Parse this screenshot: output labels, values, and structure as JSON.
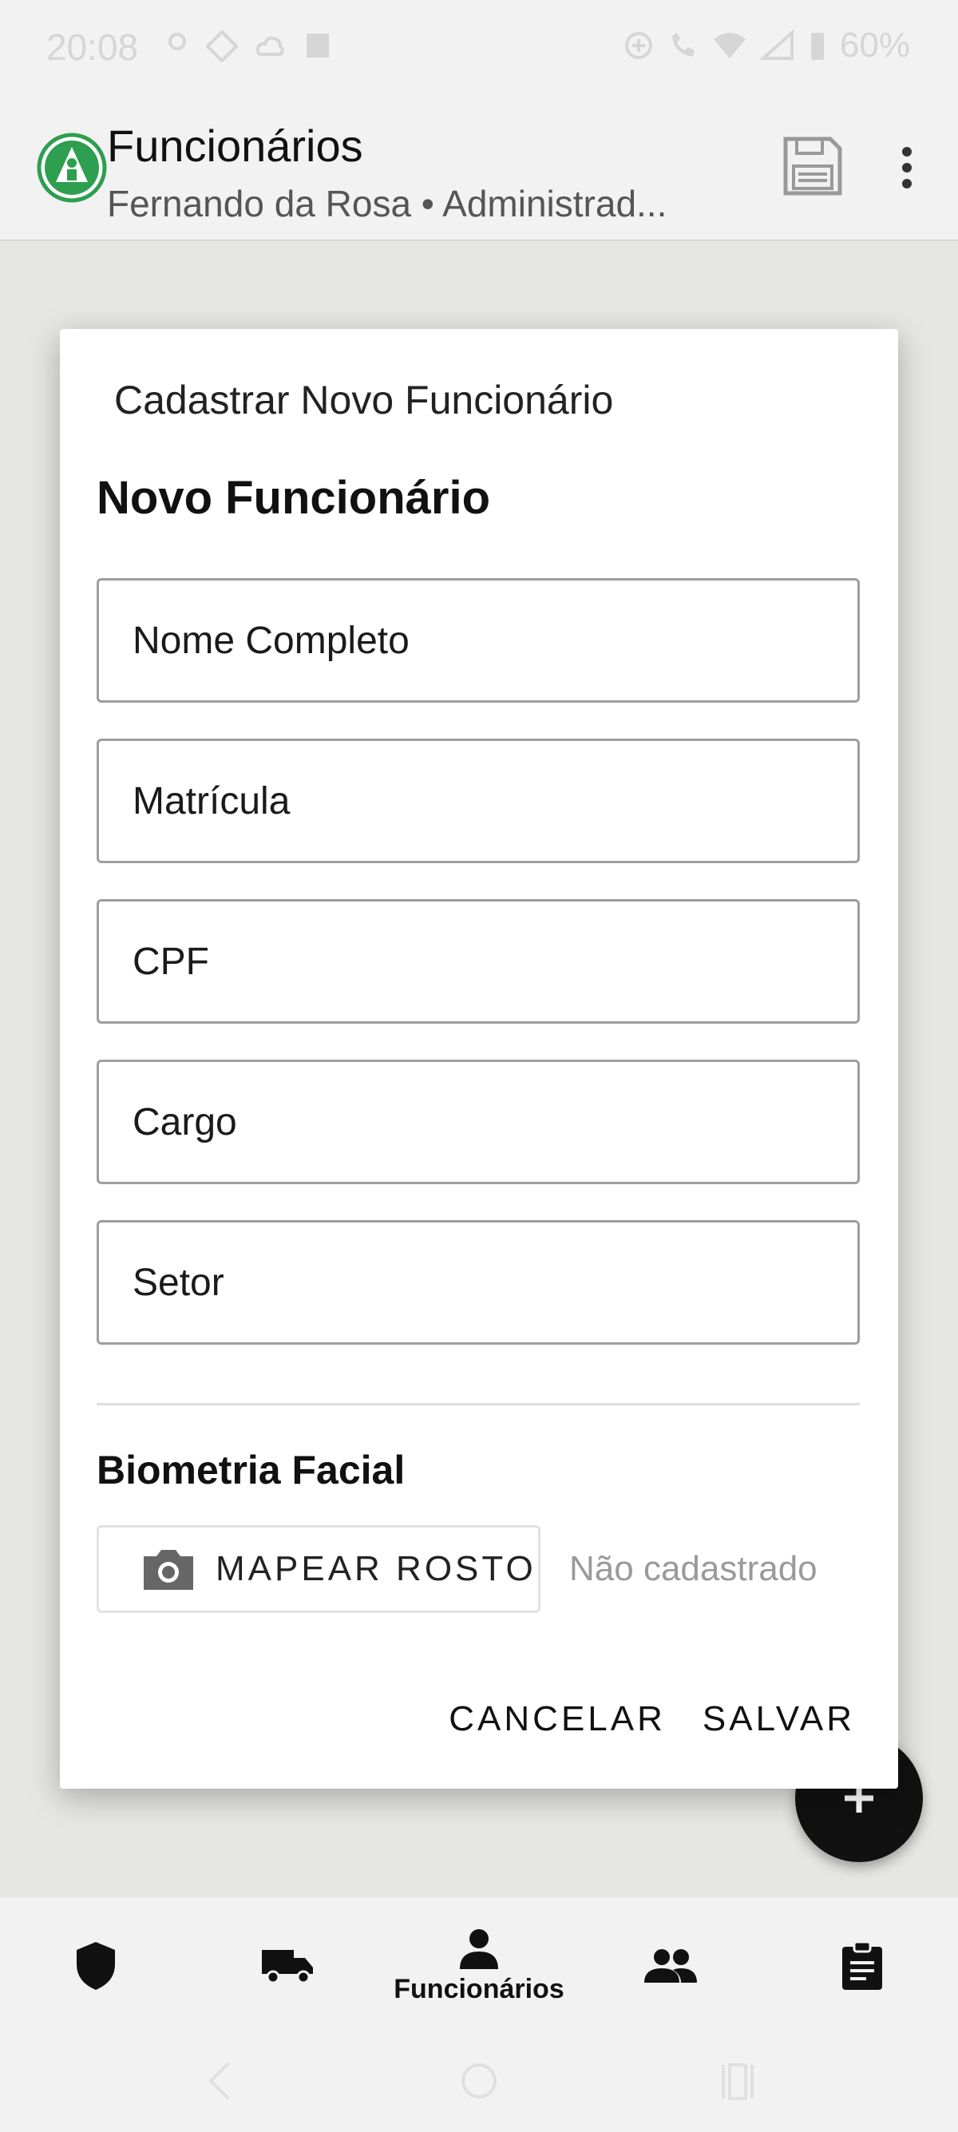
{
  "status_bar": {
    "time": "20:08",
    "battery": "60%"
  },
  "app_bar": {
    "title": "Funcionários",
    "subtitle": "Fernando da Rosa • Administrad..."
  },
  "dialog": {
    "title": "Cadastrar Novo Funcionário",
    "heading": "Novo Funcionário",
    "fields": [
      {
        "placeholder": "Nome Completo",
        "value": ""
      },
      {
        "placeholder": "Matrícula",
        "value": ""
      },
      {
        "placeholder": "CPF",
        "value": ""
      },
      {
        "placeholder": "Cargo",
        "value": ""
      },
      {
        "placeholder": "Setor",
        "value": ""
      }
    ],
    "biometrics": {
      "heading": "Biometria Facial",
      "button_label": "MAPEAR ROSTO",
      "button_icon": "camera-icon",
      "status": "Não cadastrado"
    },
    "actions": {
      "cancel": "CANCELAR",
      "save": "SALVAR"
    }
  },
  "bottom_nav": {
    "items": [
      {
        "icon": "shield-icon",
        "label": ""
      },
      {
        "icon": "truck-icon",
        "label": ""
      },
      {
        "icon": "person-icon",
        "label": "Funcionários",
        "active": true
      },
      {
        "icon": "group-icon",
        "label": ""
      },
      {
        "icon": "clipboard-icon",
        "label": ""
      }
    ]
  },
  "colors": {
    "brand_green": "#2e9e4f",
    "fab": "#111111",
    "scrim": "#e6e6e3"
  }
}
